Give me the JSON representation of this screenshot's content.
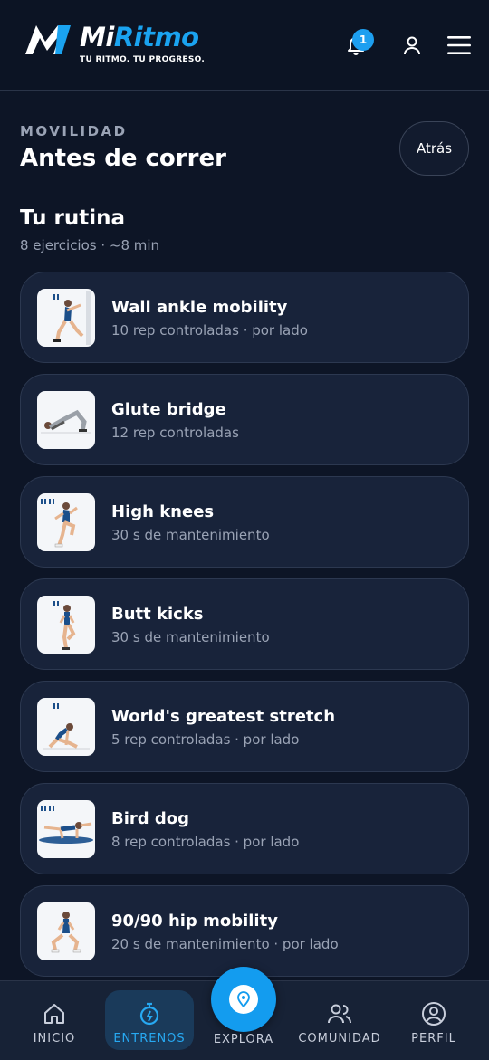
{
  "header": {
    "logo_mi": "Mi",
    "logo_ritmo": "Ritmo",
    "tagline": "TU RITMO. TU PROGRESO.",
    "notification_count": "1",
    "icons": [
      "bell-icon",
      "user-icon",
      "menu-icon"
    ]
  },
  "page": {
    "eyebrow": "MOVILIDAD",
    "title": "Antes de correr",
    "back_label": "Atrás"
  },
  "routine": {
    "title": "Tu rutina",
    "meta": "8 ejercicios · ~8 min",
    "exercises": [
      {
        "name": "Wall ankle mobility",
        "detail": "10 rep controladas · por lado"
      },
      {
        "name": "Glute bridge",
        "detail": "12 rep controladas"
      },
      {
        "name": "High knees",
        "detail": "30 s de mantenimiento"
      },
      {
        "name": "Butt kicks",
        "detail": "30 s de mantenimiento"
      },
      {
        "name": "World's greatest stretch",
        "detail": "5 rep controladas · por lado"
      },
      {
        "name": "Bird dog",
        "detail": "8 rep controladas · por lado"
      },
      {
        "name": "90/90 hip mobility",
        "detail": "20 s de mantenimiento · por lado"
      }
    ]
  },
  "nav": {
    "items": [
      {
        "label": "INICIO",
        "icon": "home-icon"
      },
      {
        "label": "ENTRENOS",
        "icon": "stopwatch-icon",
        "active": true
      },
      {
        "label": "EXPLORA",
        "icon": "location-pin-icon"
      },
      {
        "label": "COMUNIDAD",
        "icon": "users-icon"
      },
      {
        "label": "PERFIL",
        "icon": "profile-icon"
      }
    ]
  },
  "colors": {
    "background": "#0d1526",
    "card": "#18233a",
    "accent": "#1d9ff0",
    "muted_text": "#9aa3b5"
  }
}
